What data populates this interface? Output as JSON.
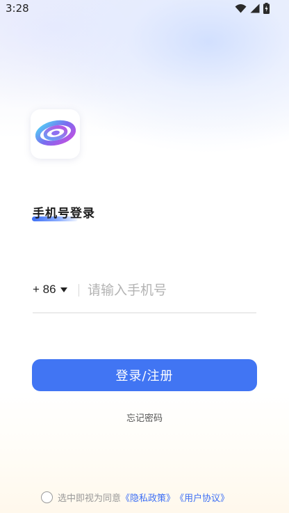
{
  "status_bar": {
    "time": "3:28",
    "icons": [
      "wifi-icon",
      "signal-icon",
      "battery-icon"
    ]
  },
  "app_icon": "swirl-logo-icon",
  "login": {
    "title": "手机号登录",
    "country_code": "+ 86",
    "phone_placeholder": "请输入手机号",
    "phone_value": "",
    "submit_label": "登录/注册",
    "forgot_password": "忘记密码"
  },
  "agreement": {
    "checked": false,
    "prefix": "选中即视为同意",
    "privacy_policy": "《隐私政策》",
    "user_agreement": "《用户协议》"
  },
  "colors": {
    "accent": "#4175f3",
    "link": "#3d6ff5"
  }
}
